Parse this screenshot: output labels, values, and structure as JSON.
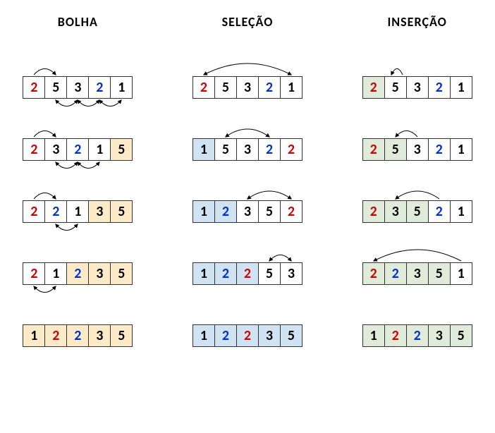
{
  "headers": [
    "BOLHA",
    "SELEÇÃO",
    "INSERÇÃO"
  ],
  "cellSize": 32,
  "colorMap": {
    "red": "#d00000",
    "blue": "#0030d0",
    "black": "#000000"
  },
  "bgMap": {
    "none": "#ffffff",
    "orange": "#fdebc8",
    "blue": "#d0e3f2",
    "green": "#e0ecd9"
  },
  "columns": [
    {
      "name": "bolha",
      "rows": [
        {
          "cells": [
            {
              "v": "2",
              "c": "red",
              "bg": "none"
            },
            {
              "v": "5",
              "c": "black",
              "bg": "none"
            },
            {
              "v": "3",
              "c": "black",
              "bg": "none"
            },
            {
              "v": "2",
              "c": "blue",
              "bg": "none"
            },
            {
              "v": "1",
              "c": "black",
              "bg": "none"
            }
          ],
          "arcsTop": [
            {
              "from": 0,
              "to": 1,
              "doubleHead": false
            }
          ],
          "arcsBottom": [
            {
              "from": 1,
              "to": 2,
              "doubleHead": true
            },
            {
              "from": 2,
              "to": 3,
              "doubleHead": true
            },
            {
              "from": 3,
              "to": 4,
              "doubleHead": true
            }
          ]
        },
        {
          "cells": [
            {
              "v": "2",
              "c": "red",
              "bg": "none"
            },
            {
              "v": "3",
              "c": "black",
              "bg": "none"
            },
            {
              "v": "2",
              "c": "blue",
              "bg": "none"
            },
            {
              "v": "1",
              "c": "black",
              "bg": "none"
            },
            {
              "v": "5",
              "c": "black",
              "bg": "orange"
            }
          ],
          "arcsTop": [
            {
              "from": 0,
              "to": 1,
              "doubleHead": false
            }
          ],
          "arcsBottom": [
            {
              "from": 1,
              "to": 2,
              "doubleHead": true
            },
            {
              "from": 2,
              "to": 3,
              "doubleHead": true
            }
          ]
        },
        {
          "cells": [
            {
              "v": "2",
              "c": "red",
              "bg": "none"
            },
            {
              "v": "2",
              "c": "blue",
              "bg": "none"
            },
            {
              "v": "1",
              "c": "black",
              "bg": "none"
            },
            {
              "v": "3",
              "c": "black",
              "bg": "orange"
            },
            {
              "v": "5",
              "c": "black",
              "bg": "orange"
            }
          ],
          "arcsTop": [
            {
              "from": 0,
              "to": 1,
              "doubleHead": false
            }
          ],
          "arcsBottom": [
            {
              "from": 1,
              "to": 2,
              "doubleHead": true
            }
          ]
        },
        {
          "cells": [
            {
              "v": "2",
              "c": "red",
              "bg": "none"
            },
            {
              "v": "1",
              "c": "black",
              "bg": "none"
            },
            {
              "v": "2",
              "c": "blue",
              "bg": "orange"
            },
            {
              "v": "3",
              "c": "black",
              "bg": "orange"
            },
            {
              "v": "5",
              "c": "black",
              "bg": "orange"
            }
          ],
          "arcsTop": [],
          "arcsBottom": [
            {
              "from": 0,
              "to": 1,
              "doubleHead": true
            }
          ]
        },
        {
          "cells": [
            {
              "v": "1",
              "c": "black",
              "bg": "orange"
            },
            {
              "v": "2",
              "c": "red",
              "bg": "orange"
            },
            {
              "v": "2",
              "c": "blue",
              "bg": "orange"
            },
            {
              "v": "3",
              "c": "black",
              "bg": "orange"
            },
            {
              "v": "5",
              "c": "black",
              "bg": "orange"
            }
          ],
          "arcsTop": [],
          "arcsBottom": []
        }
      ]
    },
    {
      "name": "selecao",
      "rows": [
        {
          "cells": [
            {
              "v": "2",
              "c": "red",
              "bg": "none"
            },
            {
              "v": "5",
              "c": "black",
              "bg": "none"
            },
            {
              "v": "3",
              "c": "black",
              "bg": "none"
            },
            {
              "v": "2",
              "c": "blue",
              "bg": "none"
            },
            {
              "v": "1",
              "c": "black",
              "bg": "none"
            }
          ],
          "arcsTop": [
            {
              "from": 0,
              "to": 4,
              "doubleHead": true
            }
          ],
          "arcsBottom": []
        },
        {
          "cells": [
            {
              "v": "1",
              "c": "black",
              "bg": "blue"
            },
            {
              "v": "5",
              "c": "black",
              "bg": "none"
            },
            {
              "v": "3",
              "c": "black",
              "bg": "none"
            },
            {
              "v": "2",
              "c": "blue",
              "bg": "none"
            },
            {
              "v": "2",
              "c": "red",
              "bg": "none"
            }
          ],
          "arcsTop": [
            {
              "from": 1,
              "to": 3,
              "doubleHead": true
            }
          ],
          "arcsBottom": []
        },
        {
          "cells": [
            {
              "v": "1",
              "c": "black",
              "bg": "blue"
            },
            {
              "v": "2",
              "c": "blue",
              "bg": "blue"
            },
            {
              "v": "3",
              "c": "black",
              "bg": "none"
            },
            {
              "v": "5",
              "c": "black",
              "bg": "none"
            },
            {
              "v": "2",
              "c": "red",
              "bg": "none"
            }
          ],
          "arcsTop": [
            {
              "from": 2,
              "to": 4,
              "doubleHead": true
            }
          ],
          "arcsBottom": []
        },
        {
          "cells": [
            {
              "v": "1",
              "c": "black",
              "bg": "blue"
            },
            {
              "v": "2",
              "c": "blue",
              "bg": "blue"
            },
            {
              "v": "2",
              "c": "red",
              "bg": "blue"
            },
            {
              "v": "5",
              "c": "black",
              "bg": "none"
            },
            {
              "v": "3",
              "c": "black",
              "bg": "none"
            }
          ],
          "arcsTop": [
            {
              "from": 3,
              "to": 4,
              "doubleHead": true
            }
          ],
          "arcsBottom": []
        },
        {
          "cells": [
            {
              "v": "1",
              "c": "black",
              "bg": "blue"
            },
            {
              "v": "2",
              "c": "blue",
              "bg": "blue"
            },
            {
              "v": "2",
              "c": "red",
              "bg": "blue"
            },
            {
              "v": "3",
              "c": "black",
              "bg": "blue"
            },
            {
              "v": "5",
              "c": "black",
              "bg": "blue"
            }
          ],
          "arcsTop": [],
          "arcsBottom": []
        }
      ]
    },
    {
      "name": "insercao",
      "rows": [
        {
          "cells": [
            {
              "v": "2",
              "c": "red",
              "bg": "green"
            },
            {
              "v": "5",
              "c": "black",
              "bg": "none"
            },
            {
              "v": "3",
              "c": "black",
              "bg": "none"
            },
            {
              "v": "2",
              "c": "blue",
              "bg": "none"
            },
            {
              "v": "1",
              "c": "black",
              "bg": "none"
            }
          ],
          "arcsTop": [
            {
              "from": 1,
              "to": 0,
              "doubleHead": false,
              "self": true
            }
          ],
          "arcsBottom": []
        },
        {
          "cells": [
            {
              "v": "2",
              "c": "red",
              "bg": "green"
            },
            {
              "v": "5",
              "c": "black",
              "bg": "green"
            },
            {
              "v": "3",
              "c": "black",
              "bg": "none"
            },
            {
              "v": "2",
              "c": "blue",
              "bg": "none"
            },
            {
              "v": "1",
              "c": "black",
              "bg": "none"
            }
          ],
          "arcsTop": [
            {
              "from": 2,
              "to": 1,
              "doubleHead": false
            }
          ],
          "arcsBottom": []
        },
        {
          "cells": [
            {
              "v": "2",
              "c": "red",
              "bg": "green"
            },
            {
              "v": "3",
              "c": "black",
              "bg": "green"
            },
            {
              "v": "5",
              "c": "black",
              "bg": "green"
            },
            {
              "v": "2",
              "c": "blue",
              "bg": "none"
            },
            {
              "v": "1",
              "c": "black",
              "bg": "none"
            }
          ],
          "arcsTop": [
            {
              "from": 3,
              "to": 1,
              "doubleHead": false
            }
          ],
          "arcsBottom": []
        },
        {
          "cells": [
            {
              "v": "2",
              "c": "red",
              "bg": "green"
            },
            {
              "v": "2",
              "c": "blue",
              "bg": "green"
            },
            {
              "v": "3",
              "c": "black",
              "bg": "green"
            },
            {
              "v": "5",
              "c": "black",
              "bg": "green"
            },
            {
              "v": "1",
              "c": "black",
              "bg": "none"
            }
          ],
          "arcsTop": [
            {
              "from": 4,
              "to": 0,
              "doubleHead": false
            }
          ],
          "arcsBottom": []
        },
        {
          "cells": [
            {
              "v": "1",
              "c": "black",
              "bg": "green"
            },
            {
              "v": "2",
              "c": "red",
              "bg": "green"
            },
            {
              "v": "2",
              "c": "blue",
              "bg": "green"
            },
            {
              "v": "3",
              "c": "black",
              "bg": "green"
            },
            {
              "v": "5",
              "c": "black",
              "bg": "green"
            }
          ],
          "arcsTop": [],
          "arcsBottom": []
        }
      ]
    }
  ],
  "chart_data": {
    "type": "table",
    "title": "Comparison of sorting algorithm steps on array [2,5,3,2,1]",
    "algorithms": {
      "BOLHA": [
        [
          2,
          5,
          3,
          2,
          1
        ],
        [
          2,
          3,
          2,
          1,
          5
        ],
        [
          2,
          2,
          1,
          3,
          5
        ],
        [
          2,
          1,
          2,
          3,
          5
        ],
        [
          1,
          2,
          2,
          3,
          5
        ]
      ],
      "SELEÇÃO": [
        [
          2,
          5,
          3,
          2,
          1
        ],
        [
          1,
          5,
          3,
          2,
          2
        ],
        [
          1,
          2,
          3,
          5,
          2
        ],
        [
          1,
          2,
          2,
          5,
          3
        ],
        [
          1,
          2,
          2,
          3,
          5
        ]
      ],
      "INSERÇÃO": [
        [
          2,
          5,
          3,
          2,
          1
        ],
        [
          2,
          5,
          3,
          2,
          1
        ],
        [
          2,
          3,
          5,
          2,
          1
        ],
        [
          2,
          2,
          3,
          5,
          1
        ],
        [
          1,
          2,
          2,
          3,
          5
        ]
      ]
    }
  }
}
